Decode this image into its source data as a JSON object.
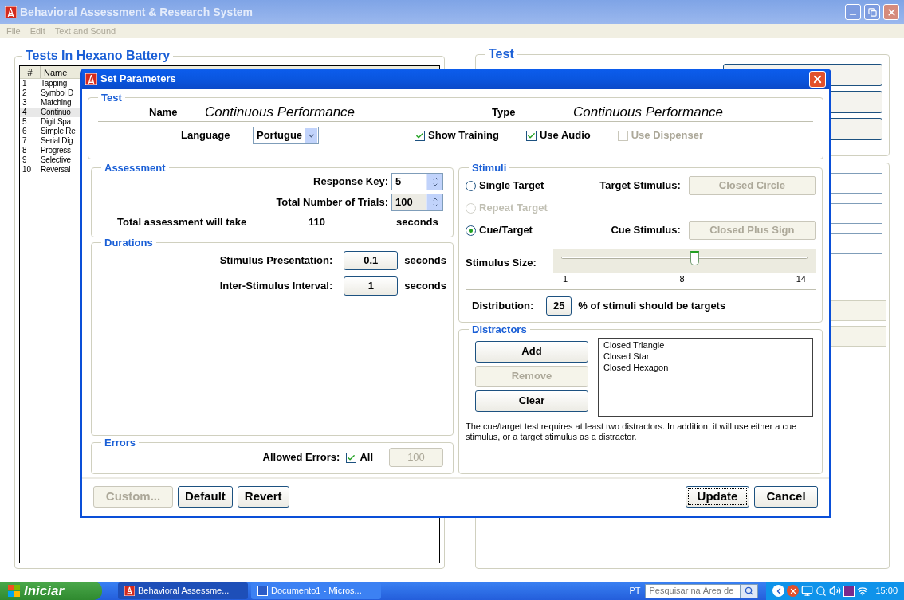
{
  "window": {
    "title": "Behavioral Assessment & Research System"
  },
  "menu": [
    "File",
    "Edit",
    "Text and Sound"
  ],
  "battery": {
    "title": "Tests In Hexano Battery",
    "columns": [
      "#",
      "Name"
    ],
    "rows": [
      {
        "number": "1",
        "name": "Tapping",
        "selected": false
      },
      {
        "number": "2",
        "name": "Symbol D",
        "selected": false
      },
      {
        "number": "3",
        "name": "Matching",
        "selected": false
      },
      {
        "number": "4",
        "name": "Continuo",
        "selected": true
      },
      {
        "number": "5",
        "name": "Digit Spa",
        "selected": false
      },
      {
        "number": "6",
        "name": "Simple Re",
        "selected": false
      },
      {
        "number": "7",
        "name": "Serial Dig",
        "selected": false
      },
      {
        "number": "8",
        "name": "Progress",
        "selected": false
      },
      {
        "number": "9",
        "name": "Selective",
        "selected": false
      },
      {
        "number": "10",
        "name": "Reversal",
        "selected": false
      }
    ]
  },
  "test_panel": {
    "title": "Test"
  },
  "dialog": {
    "title": "Set Parameters",
    "test": {
      "title": "Test",
      "name_label": "Name",
      "name": "Continuous Performance",
      "type_label": "Type",
      "type": "Continuous Performance",
      "language_label": "Language",
      "language": "Portugue",
      "options": [
        {
          "label": "Show Training",
          "checked": true,
          "disabled": false
        },
        {
          "label": "Use Audio",
          "checked": true,
          "disabled": false
        },
        {
          "label": "Use Dispenser",
          "checked": false,
          "disabled": true
        }
      ]
    },
    "assessment": {
      "title": "Assessment",
      "response_key_label": "Response Key:",
      "response_key": "5",
      "trials_label": "Total Number of Trials:",
      "trials": "100",
      "total_label": "Total assessment will take",
      "total": "110",
      "total_unit": "seconds"
    },
    "durations": {
      "title": "Durations",
      "rows": [
        {
          "label": "Stimulus Presentation:",
          "value": "0.1",
          "unit": "seconds"
        },
        {
          "label": "Inter-Stimulus Interval:",
          "value": "1",
          "unit": "seconds"
        }
      ]
    },
    "errors": {
      "title": "Errors",
      "label": "Allowed Errors:",
      "all_label": "All",
      "all_checked": true,
      "value": "100"
    },
    "stimuli": {
      "title": "Stimuli",
      "modes": [
        {
          "label": "Single Target",
          "selected": false,
          "disabled": false,
          "field_label": "Target Stimulus:",
          "field_value": "Closed Circle"
        },
        {
          "label": "Repeat Target",
          "selected": false,
          "disabled": true
        },
        {
          "label": "Cue/Target",
          "selected": true,
          "disabled": false,
          "field_label": "Cue Stimulus:",
          "field_value": "Closed Plus Sign"
        }
      ],
      "size_label": "Stimulus Size:",
      "size": {
        "level": 0.54
      },
      "size_ticks": [
        "1",
        "8",
        "14"
      ],
      "distribution_label": "Distribution:",
      "distribution": "25",
      "distribution_suffix": "% of stimuli should be targets"
    },
    "distractors": {
      "title": "Distractors",
      "buttons": [
        {
          "label": "Add",
          "disabled": false
        },
        {
          "label": "Remove",
          "disabled": true
        },
        {
          "label": "Clear",
          "disabled": false
        }
      ],
      "items": [
        "Closed Triangle",
        "Closed Star",
        "Closed Hexagon"
      ],
      "note": "The cue/target test requires at least two distractors. In addition, it will use either a cue stimulus, or a target stimulus as a distractor."
    },
    "footer": {
      "left_buttons": [
        {
          "label": "Custom...",
          "disabled": true
        },
        {
          "label": "Default",
          "disabled": false
        },
        {
          "label": "Revert",
          "disabled": false
        }
      ],
      "right_buttons": [
        {
          "label": "Update",
          "focused": true
        },
        {
          "label": "Cancel",
          "focused": false
        }
      ]
    }
  },
  "taskbar": {
    "start": "Iniciar",
    "tasks": [
      {
        "label": "Behavioral Assessme...",
        "kind": "app",
        "selected": true
      },
      {
        "label": "Documento1 - Micros...",
        "kind": "word",
        "selected": false
      }
    ],
    "language": "PT",
    "search_placeholder": "Pesquisar na Área de",
    "clock": "15:00"
  }
}
